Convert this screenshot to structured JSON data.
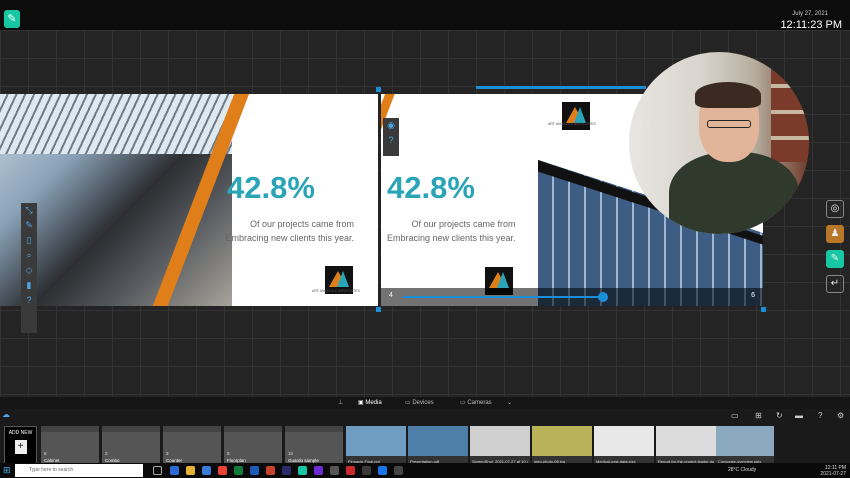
{
  "header": {
    "date": "July 27, 2021",
    "time": "12:11:23 PM"
  },
  "slide": {
    "stat": "42.8%",
    "line1": "Of our projects came from",
    "line2": "Embracing new clients this year.",
    "company": "ART ANGELA & ASSOCIATES"
  },
  "player": {
    "current": "4",
    "total": "6"
  },
  "tabs": {
    "media": "Media",
    "devices": "Devices",
    "cameras": "Cameras"
  },
  "media": {
    "add_new": "ADD NEW",
    "folders": [
      {
        "count": "8",
        "name": "Cabinet"
      },
      {
        "count": "2",
        "name": "Combo"
      },
      {
        "count": "3",
        "name": "Counter"
      },
      {
        "count": "5",
        "name": "Floorplan"
      },
      {
        "count": "10",
        "name": "Guardo sample"
      }
    ],
    "files": [
      {
        "name": "Pinnacle Final.ppt",
        "color": "#6f9dc2"
      },
      {
        "name": "Presentation.pdf",
        "color": "#4d7fa8"
      },
      {
        "name": "ScreenShot_2021-07-27 at 10.44.05 am.png",
        "color": "#cfcfcf"
      },
      {
        "name": "jpeg-photo-08.jpg",
        "color": "#b9b259"
      },
      {
        "name": "Medical-cost-data.xlsx",
        "color": "#e8e8e8"
      },
      {
        "name": "Report-for-the-project-leader.docx",
        "color": "#dcdcdc"
      },
      {
        "name": "Corporate-overview.pptx",
        "color": "#8aa8be"
      }
    ]
  },
  "taskbar": {
    "search_placeholder": "Type here to search",
    "weather": "28°C  Cloudy",
    "tray_time": "12:11 PM",
    "tray_date": "2021-07-27"
  },
  "colors": {
    "accent": "#17c7a4",
    "blue": "#1a8fd8",
    "teal_text": "#2aa5b7",
    "orange": "#e07f1a"
  }
}
